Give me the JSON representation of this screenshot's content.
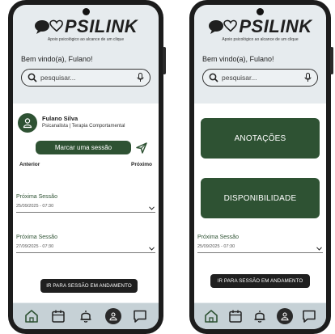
{
  "brand": {
    "name": "PSILINK",
    "tagline": "Apoio psicológico ao alcance de um clique"
  },
  "colors": {
    "primary_green": "#2e5233",
    "dark_button": "#1f1f1f",
    "screen_bg": "#e6ebee",
    "tabbar_bg": "#c6d1d6"
  },
  "screens": [
    {
      "welcome": "Bem vindo(a), Fulano!",
      "search": {
        "placeholder": "pesquisar..."
      },
      "professional": {
        "name": "Fulano Silva",
        "role": "Psicanalista | Terapia Comportamental"
      },
      "schedule_button": "Marcar uma sessão",
      "nav": {
        "previous": "Anterior",
        "next": "Próximo"
      },
      "sessions": [
        {
          "label": "Próxima Sessão",
          "date": "25/09/2025 - 07:30"
        },
        {
          "label": "Próxima Sessão",
          "date": "27/09/2025 - 07:30"
        }
      ],
      "go_session_button": "IR PARA SESSÃO EM ANDAMENTO"
    },
    {
      "welcome": "Bem vindo(a), Fulano!",
      "search": {
        "placeholder": "pesquisar..."
      },
      "notes_button": "ANOTAÇÕES",
      "availability_button": "DISPONIBILIDADE",
      "sessions": [
        {
          "label": "Próxima Sessão",
          "date": "25/09/2025 - 07:30"
        }
      ],
      "go_session_button": "IR PARA SESSÃO EM ANDAMENTO"
    }
  ],
  "tabbar": [
    {
      "icon": "home-icon"
    },
    {
      "icon": "calendar-icon"
    },
    {
      "icon": "bell-icon"
    },
    {
      "icon": "profile-icon"
    },
    {
      "icon": "chat-icon"
    }
  ]
}
